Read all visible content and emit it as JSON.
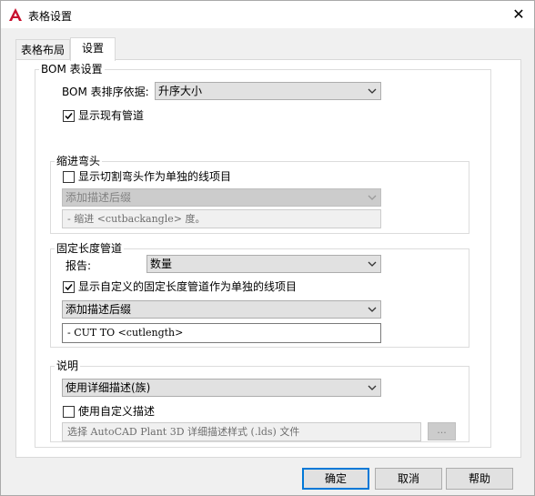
{
  "window": {
    "title": "表格设置"
  },
  "tabs": {
    "layout": "表格布局",
    "settings": "设置"
  },
  "bom": {
    "group_label": "BOM 表设置",
    "sort_label": "BOM 表排序依据:",
    "sort_value": "升序大小",
    "show_existing_label": "显示现有管道",
    "show_existing_checked": true
  },
  "cutback": {
    "group_label": "缩进弯头",
    "show_separate_label": "显示切割弯头作为单独的线项目",
    "show_separate_checked": false,
    "suffix_combo": "添加描述后缀",
    "suffix_text": "- 缩进 <cutbackangle> 度。"
  },
  "fixed_length": {
    "group_label": "固定长度管道",
    "report_label": "报告:",
    "report_value": "数量",
    "show_custom_label": "显示自定义的固定长度管道作为单独的线项目",
    "show_custom_checked": true,
    "suffix_combo": "添加描述后缀",
    "suffix_text": "- CUT TO <cutlength>"
  },
  "description": {
    "group_label": "说明",
    "desc_value": "使用详细描述(族)",
    "use_custom_label": "使用自定义描述",
    "use_custom_checked": false,
    "file_placeholder": "选择 AutoCAD Plant 3D 详细描述样式 (.lds) 文件",
    "browse_label": "..."
  },
  "buttons": {
    "ok": "确定",
    "cancel": "取消",
    "help": "帮助"
  },
  "colors": {
    "accent": "#0078d7",
    "app_icon": "#c8102e"
  }
}
